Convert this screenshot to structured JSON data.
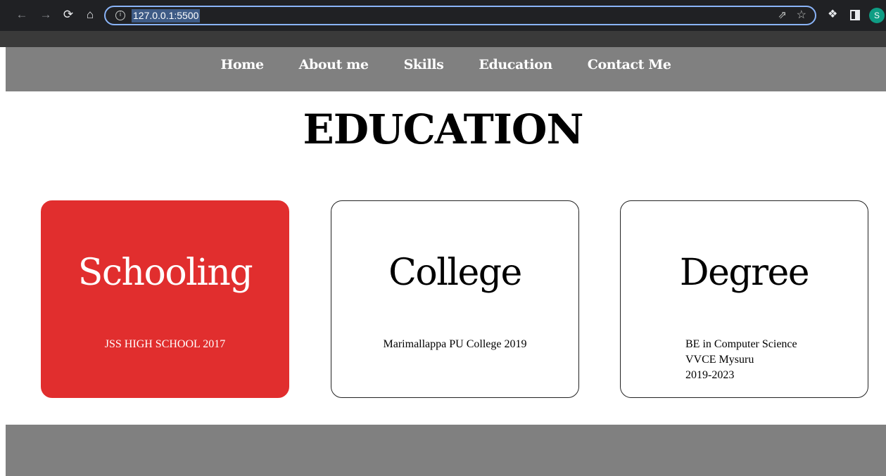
{
  "browser": {
    "url": "127.0.0.1:5500",
    "avatar_letter": "S",
    "icons": [
      "back-arrow-icon",
      "forward-arrow-icon",
      "reload-icon",
      "home-icon",
      "info-icon",
      "share-icon",
      "star-icon",
      "extensions-icon",
      "side-panel-icon"
    ]
  },
  "nav": {
    "items": [
      "Home",
      "About me",
      "Skills",
      "Education",
      "Contact Me"
    ]
  },
  "page": {
    "title": "EDUCATION"
  },
  "cards": [
    {
      "title": "Schooling",
      "lines": [
        "JSS HIGH SCHOOL 2017"
      ],
      "active": true
    },
    {
      "title": "College",
      "lines": [
        "Marimallappa PU College 2019"
      ],
      "active": false
    },
    {
      "title": "Degree",
      "lines": [
        "BE in Computer Science",
        "VVCE Mysuru",
        "2019-2023"
      ],
      "active": false
    }
  ],
  "colors": {
    "nav_bg": "#808080",
    "active_card": "#e12e2e",
    "chrome_bg": "#202124",
    "omnibox_focus": "#8ab4f8"
  }
}
